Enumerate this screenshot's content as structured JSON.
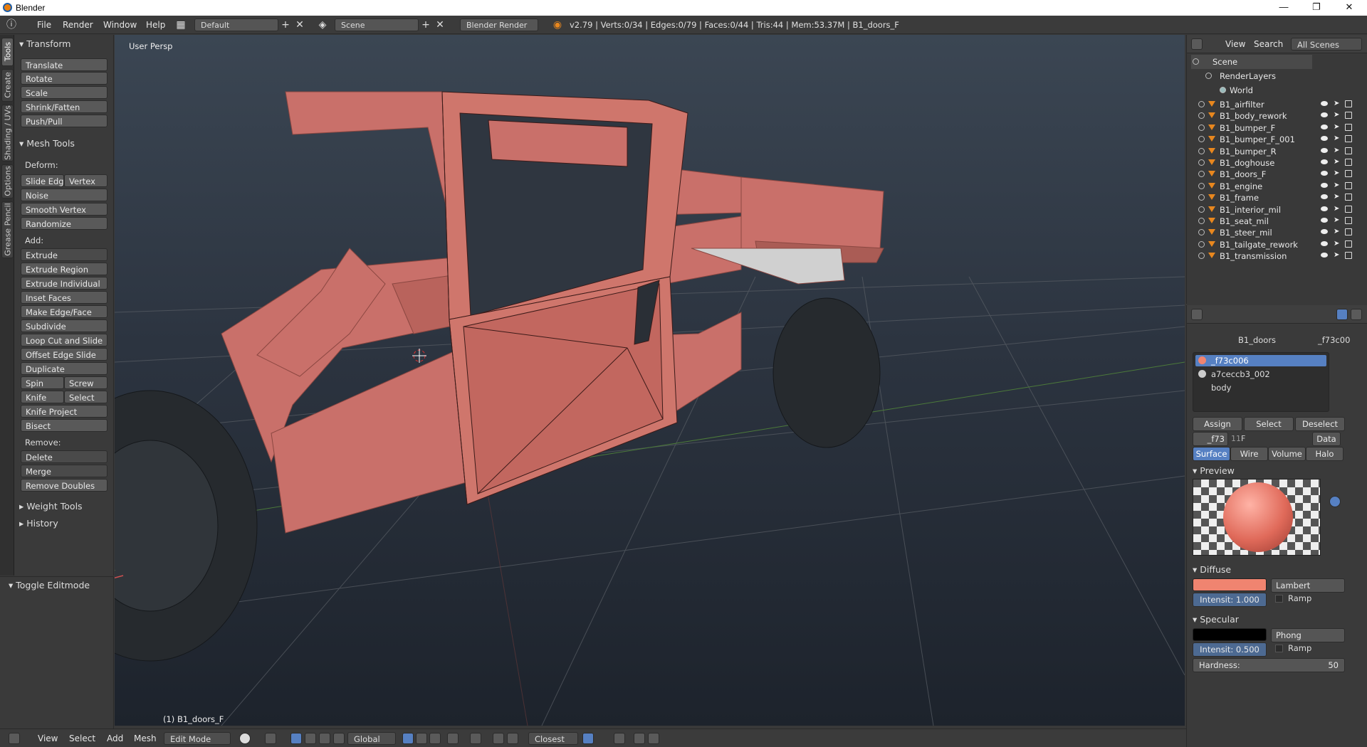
{
  "window": {
    "title": "Blender",
    "minimize": "—",
    "maximize": "❐",
    "close": "✕"
  },
  "menu": {
    "items": [
      "File",
      "Render",
      "Window",
      "Help"
    ],
    "layout": "Default",
    "scene": "Scene",
    "engine": "Blender Render",
    "stats": "v2.79 | Verts:0/34 | Edges:0/79 | Faces:0/44 | Tris:44 | Mem:53.37M | B1_doors_F"
  },
  "vtabs": [
    "Tools",
    "Create",
    "Shading / UVs",
    "Options",
    "Grease Pencil"
  ],
  "toolshelf": {
    "transform": {
      "title": "Transform",
      "buttons": [
        "Translate",
        "Rotate",
        "Scale",
        "Shrink/Fatten",
        "Push/Pull"
      ]
    },
    "mesh_tools": {
      "title": "Mesh Tools",
      "deform_label": "Deform:",
      "slide_edge": "Slide Edge",
      "vertex": "Vertex",
      "noise": "Noise",
      "smooth_vertex": "Smooth Vertex",
      "randomize": "Randomize",
      "add_label": "Add:",
      "extrude": "Extrude",
      "extrude_region": "Extrude Region",
      "extrude_individual": "Extrude Individual",
      "inset_faces": "Inset Faces",
      "make_edge_face": "Make Edge/Face",
      "subdivide": "Subdivide",
      "loop_cut": "Loop Cut and Slide",
      "offset_edge": "Offset Edge Slide",
      "duplicate": "Duplicate",
      "spin": "Spin",
      "screw": "Screw",
      "knife": "Knife",
      "select": "Select",
      "knife_project": "Knife Project",
      "bisect": "Bisect",
      "remove_label": "Remove:",
      "delete": "Delete",
      "merge": "Merge",
      "remove_doubles": "Remove Doubles"
    },
    "weight_tools": "Weight Tools",
    "history": "History",
    "toggle_editmode": "Toggle Editmode"
  },
  "viewport": {
    "view_label": "User Persp",
    "object_label": "(1) B1_doors_F",
    "mesh_color": "#d2776c"
  },
  "bottombar": {
    "items": [
      "View",
      "Select",
      "Add",
      "Mesh"
    ],
    "mode": "Edit Mode",
    "orientation": "Global",
    "snap": "Closest"
  },
  "outliner": {
    "tabs": [
      "View",
      "Search",
      "All Scenes"
    ],
    "scene": "Scene",
    "render_layers": "RenderLayers",
    "world": "World",
    "objects": [
      "B1_airfilter",
      "B1_body_rework",
      "B1_bumper_F",
      "B1_bumper_F_001",
      "B1_bumper_R",
      "B1_doghouse",
      "B1_doors_F",
      "B1_engine",
      "B1_frame",
      "B1_interior_mil",
      "B1_seat_mil",
      "B1_steer_mil",
      "B1_tailgate_rework",
      "B1_transmission"
    ]
  },
  "properties": {
    "object": "B1_doors",
    "material": "_f73c00",
    "slots": [
      "_f73c006",
      "a7ceccb3_002",
      "body"
    ],
    "assign": "Assign",
    "select": "Select",
    "deselect": "Deselect",
    "mat_short": "_f73",
    "users": "11",
    "fake": "F",
    "data": "Data",
    "tabs": [
      "Surface",
      "Wire",
      "Volume",
      "Halo"
    ],
    "preview": "Preview",
    "diffuse": {
      "title": "Diffuse",
      "shader": "Lambert",
      "intensity": "Intensit: 1.000",
      "ramp": "Ramp",
      "color": "#f08470"
    },
    "specular": {
      "title": "Specular",
      "shader": "Phong",
      "intensity": "Intensit: 0.500",
      "ramp": "Ramp",
      "color": "#000000"
    },
    "hardness_label": "Hardness:",
    "hardness": "50"
  }
}
